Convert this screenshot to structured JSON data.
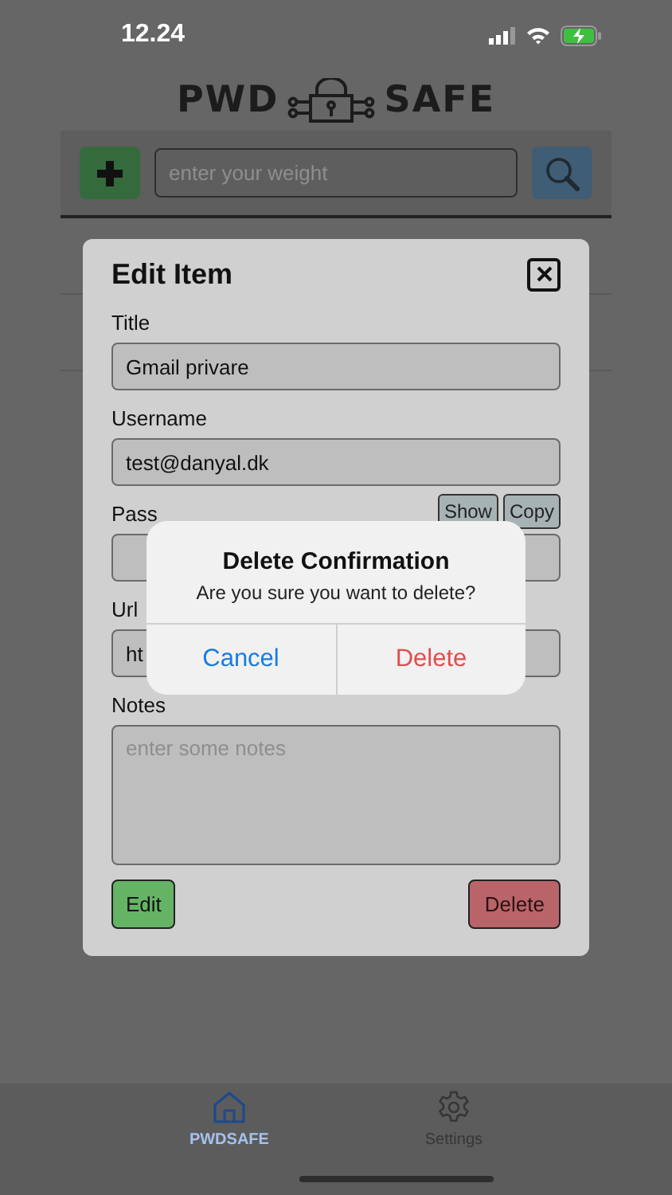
{
  "status_bar": {
    "time": "12.24"
  },
  "logo": {
    "left": "PWD",
    "right": "SAFE"
  },
  "toolbar": {
    "search_placeholder": "enter your weight"
  },
  "edit_item": {
    "title": "Edit Item",
    "fields": [
      {
        "kind": "input",
        "label": "Title",
        "value": "Gmail privare"
      },
      {
        "kind": "input",
        "label": "Username",
        "value": "test@danyal.dk"
      },
      {
        "kind": "input",
        "label": "Pass",
        "actions": [
          "Show",
          "Copy"
        ]
      },
      {
        "kind": "input",
        "label": "Url",
        "value": "ht"
      },
      {
        "kind": "textarea",
        "label": "Notes",
        "placeholder": "enter some notes"
      }
    ],
    "buttons": [
      {
        "label": "Edit",
        "kind": "confirm"
      },
      {
        "label": "Delete",
        "kind": "danger"
      }
    ]
  },
  "alert": {
    "title": "Delete Confirmation",
    "message": "Are you sure you want to delete?",
    "buttons": [
      {
        "label": "Cancel",
        "kind": "cancel"
      },
      {
        "label": "Delete",
        "kind": "destructive"
      }
    ]
  },
  "tab_bar": [
    {
      "label": "PWDSAFE",
      "kind": "home",
      "selected": true
    },
    {
      "label": "Settings",
      "kind": "settings",
      "selected": false
    }
  ]
}
